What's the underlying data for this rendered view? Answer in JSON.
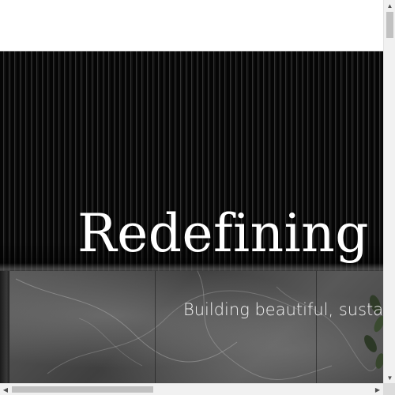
{
  "hero": {
    "title": "Redefining M",
    "subtitle": "Building beautiful, sustaina"
  },
  "scrollbars": {
    "vertical": {
      "up_icon": "arrow-up-icon",
      "down_icon": "arrow-down-icon",
      "up_glyph": "▲",
      "down_glyph": "▼"
    },
    "horizontal": {
      "left_icon": "arrow-left-icon",
      "right_icon": "arrow-right-icon",
      "left_glyph": "◀",
      "right_glyph": "▶"
    }
  },
  "colors": {
    "hero_background": "#0b0b0b",
    "title_text": "#ffffff",
    "scrollbar_track": "#f1f1f1",
    "scrollbar_thumb": "#c1c1c1"
  }
}
